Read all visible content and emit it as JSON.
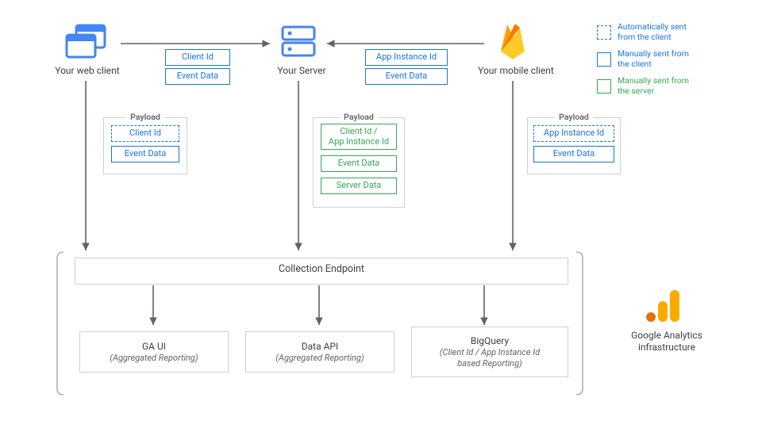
{
  "colors": {
    "blue": "#1a73e8",
    "green": "#34a853",
    "orange": "#f29900",
    "arrow": "#5f6368",
    "frame": "#d0d0d0"
  },
  "nodes": {
    "web_client": "Your web client",
    "server": "Your Server",
    "mobile_client": "Your mobile client"
  },
  "arrow_boxes": {
    "web_to_server": {
      "client_id": "Client Id",
      "event_data": "Event Data"
    },
    "mobile_to_server": {
      "app_instance_id": "App Instance Id",
      "event_data": "Event Data"
    }
  },
  "payloads": {
    "label": "Payload",
    "web": {
      "client_id": "Client Id",
      "event_data": "Event Data",
      "client_id_style": "blue-dashed",
      "event_data_style": "blue-solid"
    },
    "server": {
      "ids": "Client Id /\nApp Instance Id",
      "event": "Event Data",
      "server": "Server Data",
      "style": "green-solid"
    },
    "mobile": {
      "app_instance_id": "App Instance Id",
      "event_data": "Event Data",
      "app_instance_id_style": "blue-dashed",
      "event_data_style": "blue-solid"
    }
  },
  "collection_endpoint": "Collection Endpoint",
  "reports": {
    "ga_ui": {
      "title": "GA UI",
      "sub": "(Aggregated Reporting)"
    },
    "data_api": {
      "title": "Data API",
      "sub": "(Aggregated Reporting)"
    },
    "bigquery": {
      "title": "BigQuery",
      "sub": "(Client Id / App Instance Id\nbased Reporting)"
    }
  },
  "ga_infra": "Google Analytics\ninfrastructure",
  "legend": {
    "auto_client": "Automatically sent from the client",
    "manual_client": "Manually sent from the client",
    "manual_server": "Manually sent from the server"
  },
  "icons": {
    "web": "browser-windows-icon",
    "server": "server-stack-icon",
    "firebase": "firebase-icon",
    "analytics": "google-analytics-icon"
  }
}
